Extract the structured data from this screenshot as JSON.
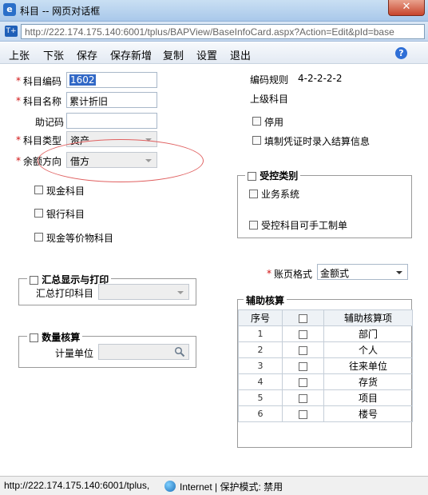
{
  "window": {
    "title": "科目 -- 网页对话框",
    "close_label": "✕",
    "url": "http://222.174.175.140:6001/tplus/BAPView/BaseInfoCard.aspx?Action=Edit&pId=base"
  },
  "toolbar": {
    "items": [
      "上张",
      "下张",
      "保存",
      "保存新增",
      "复制",
      "设置",
      "退出"
    ],
    "help_label": "?"
  },
  "form": {
    "code_label": "科目编码",
    "code_value": "1602",
    "name_label": "科目名称",
    "name_value": "累计折旧",
    "mnemonic_label": "助记码",
    "mnemonic_value": "",
    "type_label": "科目类型",
    "type_value": "资产",
    "direction_label": "余额方向",
    "direction_value": "借方",
    "cash_label": "现金科目",
    "bank_label": "银行科目",
    "cash_equiv_label": "现金等价物科目",
    "required_mark": "*"
  },
  "right": {
    "code_rule_label": "编码规则",
    "code_rule_value": "4-2-2-2-2",
    "parent_label": "上级科目",
    "disabled_label": "停用",
    "voucher_settle_label": "填制凭证时录入结算信息",
    "controlled_title": "受控类别",
    "business_system_label": "业务系统",
    "manual_entry_label": "受控科目可手工制单",
    "ledger_format_label": "账页格式",
    "ledger_format_value": "金额式"
  },
  "summary": {
    "title": "汇总显示与打印",
    "print_label": "汇总打印科目",
    "print_value": ""
  },
  "quantity": {
    "title": "数量核算",
    "unit_label": "计量单位",
    "unit_value": ""
  },
  "aux": {
    "title": "辅助核算",
    "col_index": "序号",
    "col_item": "辅助核算项",
    "rows": [
      {
        "idx": "1",
        "item": "部门"
      },
      {
        "idx": "2",
        "item": "个人"
      },
      {
        "idx": "3",
        "item": "往来单位"
      },
      {
        "idx": "4",
        "item": "存货"
      },
      {
        "idx": "5",
        "item": "项目"
      },
      {
        "idx": "6",
        "item": "楼号"
      }
    ]
  },
  "status": {
    "url": "http://222.174.175.140:6001/tplus,",
    "zone": "Internet | 保护模式: 禁用"
  }
}
